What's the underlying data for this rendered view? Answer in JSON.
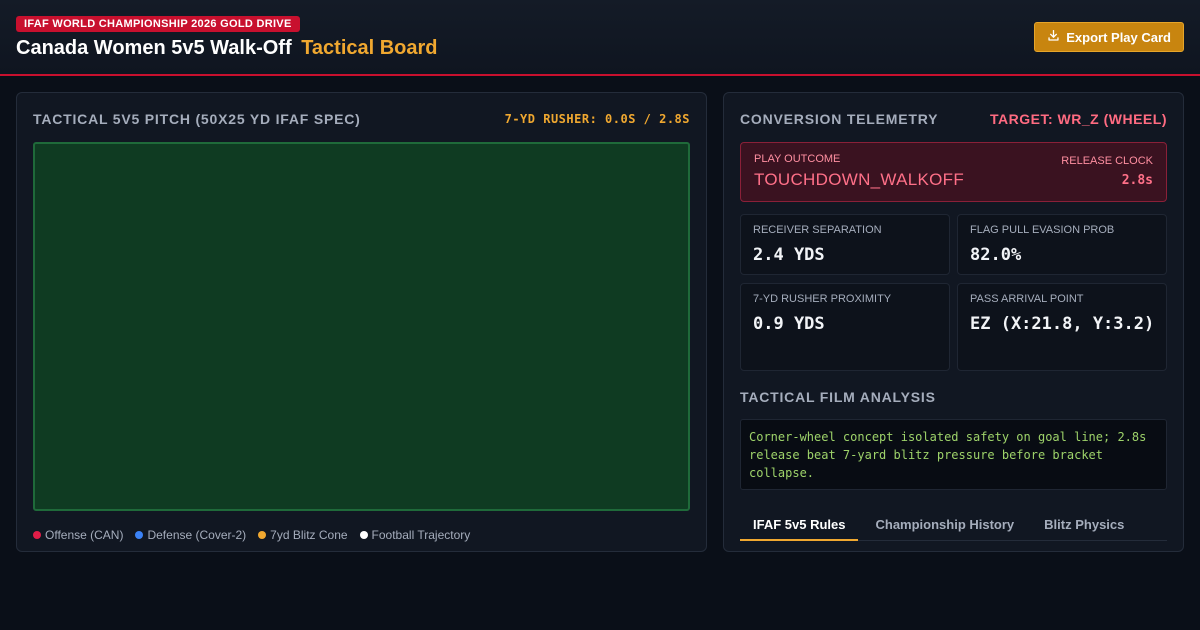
{
  "header": {
    "badge": "IFAF WORLD CHAMPIONSHIP 2026 GOLD DRIVE",
    "title": "Canada Women 5v5 Walk-Off",
    "title_accent": "Tactical Board",
    "export_label": "Export Play Card",
    "export_icon": "download-icon"
  },
  "pitch_panel": {
    "title": "TACTICAL 5V5 PITCH (50X25 YD IFAF SPEC)",
    "rusher_readout": "7-YD RUSHER: 0.0S / 2.8S",
    "legend": [
      {
        "label": "Offense (CAN)",
        "color": "#e11d48"
      },
      {
        "label": "Defense (Cover-2)",
        "color": "#3b82f6"
      },
      {
        "label": "7yd Blitz Cone",
        "color": "#f0a830"
      },
      {
        "label": "Football Trajectory",
        "color": "#ffffff"
      }
    ]
  },
  "telemetry": {
    "title": "CONVERSION TELEMETRY",
    "target": "TARGET: WR_Z (WHEEL)",
    "outcome_label": "PLAY OUTCOME",
    "outcome_value": "TOUCHDOWN_WALKOFF",
    "release_label": "RELEASE CLOCK",
    "release_value": "2.8s",
    "metrics": [
      {
        "label": "RECEIVER SEPARATION",
        "value": "2.4 YDS"
      },
      {
        "label": "FLAG PULL EVASION PROB",
        "value": "82.0%"
      },
      {
        "label": "7-YD RUSHER PROXIMITY",
        "value": "0.9 YDS"
      },
      {
        "label": "PASS ARRIVAL POINT",
        "value": "EZ (X:21.8, Y:3.2)"
      }
    ]
  },
  "film": {
    "title": "TACTICAL FILM ANALYSIS",
    "text": "Corner-wheel concept isolated safety on goal line; 2.8s release beat 7-yard blitz pressure before bracket collapse."
  },
  "tabs": [
    {
      "label": "IFAF 5v5 Rules",
      "active": true
    },
    {
      "label": "Championship History",
      "active": false
    },
    {
      "label": "Blitz Physics",
      "active": false
    }
  ],
  "colors": {
    "accent": "#f0a830",
    "brand": "#c8102e",
    "pitch": "#0f3b22"
  }
}
